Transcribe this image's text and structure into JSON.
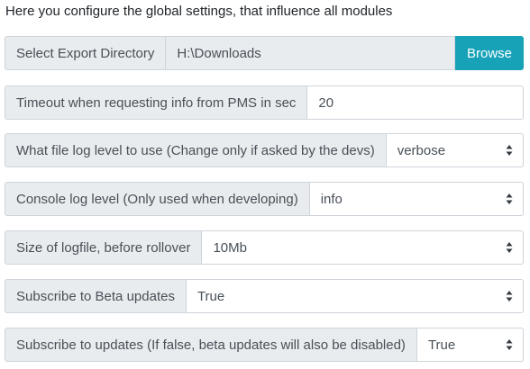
{
  "intro": "Here you configure the global settings, that influence all modules",
  "export_dir": {
    "label": "Select Export Directory",
    "value": "H:\\Downloads",
    "button_label": "Browse"
  },
  "timeout": {
    "label": "Timeout when requesting info from PMS in sec",
    "value": "20"
  },
  "file_log_level": {
    "label": "What file log level to use (Change only if asked by the devs)",
    "value": "verbose"
  },
  "console_log_level": {
    "label": "Console log level (Only used when developing)",
    "value": "info"
  },
  "logfile_size": {
    "label": "Size of logfile, before rollover",
    "value": "10Mb"
  },
  "beta_updates": {
    "label": "Subscribe to Beta updates",
    "value": "True"
  },
  "updates": {
    "label": "Subscribe to updates (If false, beta updates will also be disabled)",
    "value": "True"
  },
  "colors": {
    "browse_button": "#17a2b8",
    "label_background": "#e9ecef",
    "border": "#ced4da"
  }
}
